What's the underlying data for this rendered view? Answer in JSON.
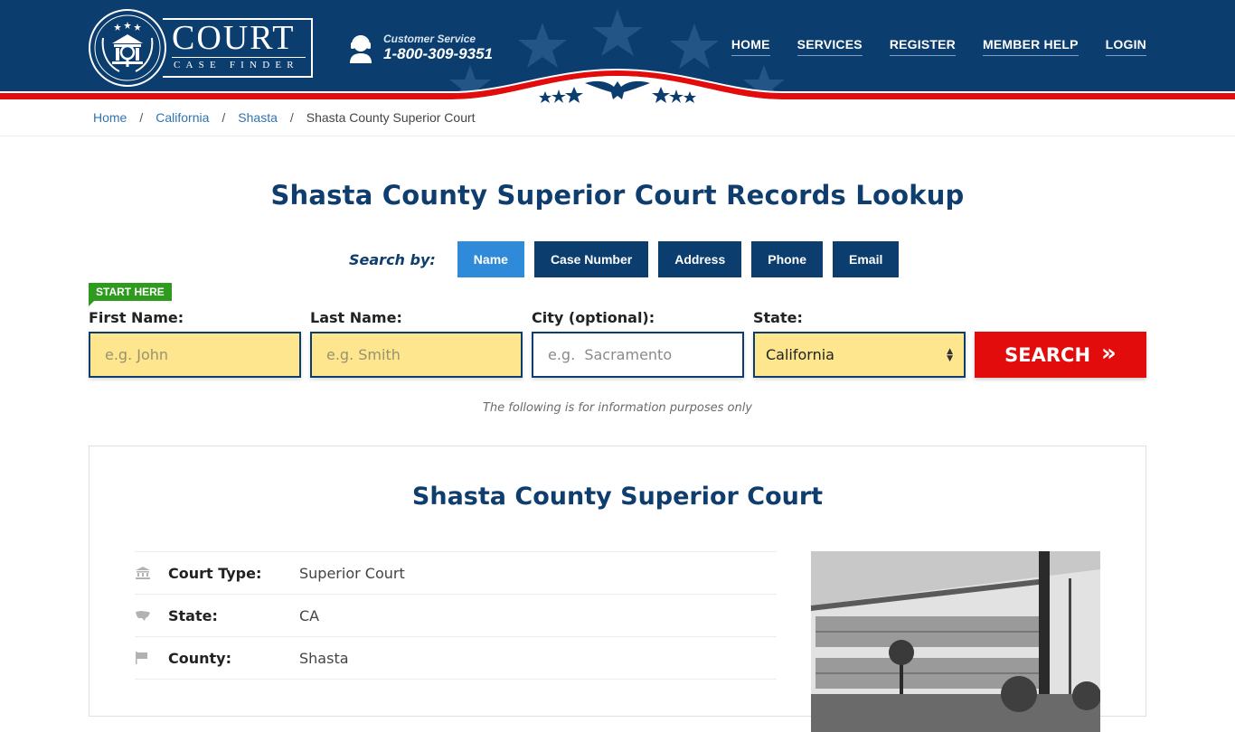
{
  "header": {
    "logo": {
      "title": "COURT",
      "subtitle": "CASE FINDER"
    },
    "customer_service": {
      "label": "Customer Service",
      "phone": "1-800-309-9351"
    },
    "nav": [
      {
        "label": "HOME"
      },
      {
        "label": "SERVICES"
      },
      {
        "label": "REGISTER"
      },
      {
        "label": "MEMBER HELP"
      },
      {
        "label": "LOGIN"
      }
    ],
    "colors": {
      "navy": "#0b3d6f",
      "red": "#e20c0c"
    }
  },
  "breadcrumb": {
    "items": [
      {
        "label": "Home"
      },
      {
        "label": "California"
      },
      {
        "label": "Shasta"
      }
    ],
    "current": "Shasta County Superior Court",
    "separator": "/"
  },
  "main": {
    "title": "Shasta County Superior Court Records Lookup",
    "search_by": {
      "label": "Search by:",
      "tabs": [
        {
          "label": "Name",
          "active": true
        },
        {
          "label": "Case Number",
          "active": false
        },
        {
          "label": "Address",
          "active": false
        },
        {
          "label": "Phone",
          "active": false
        },
        {
          "label": "Email",
          "active": false
        }
      ]
    },
    "form": {
      "badge": "START HERE",
      "first_name": {
        "label": "First Name:",
        "placeholder": "e.g. John",
        "value": ""
      },
      "last_name": {
        "label": "Last Name:",
        "placeholder": "e.g. Smith",
        "value": ""
      },
      "city": {
        "label": "City (optional):",
        "placeholder": "e.g.  Sacramento",
        "value": ""
      },
      "state": {
        "label": "State:",
        "selected": "California"
      },
      "search_button": {
        "label": "SEARCH",
        "icon": "double-chevron-right"
      }
    },
    "note": "The following is for information purposes only"
  },
  "court": {
    "title": "Shasta County Superior Court",
    "details": [
      {
        "icon": "courthouse-icon",
        "label": "Court Type:",
        "value": "Superior Court"
      },
      {
        "icon": "us-map-icon",
        "label": "State:",
        "value": "CA"
      },
      {
        "icon": "flag-icon",
        "label": "County:",
        "value": "Shasta"
      }
    ]
  }
}
